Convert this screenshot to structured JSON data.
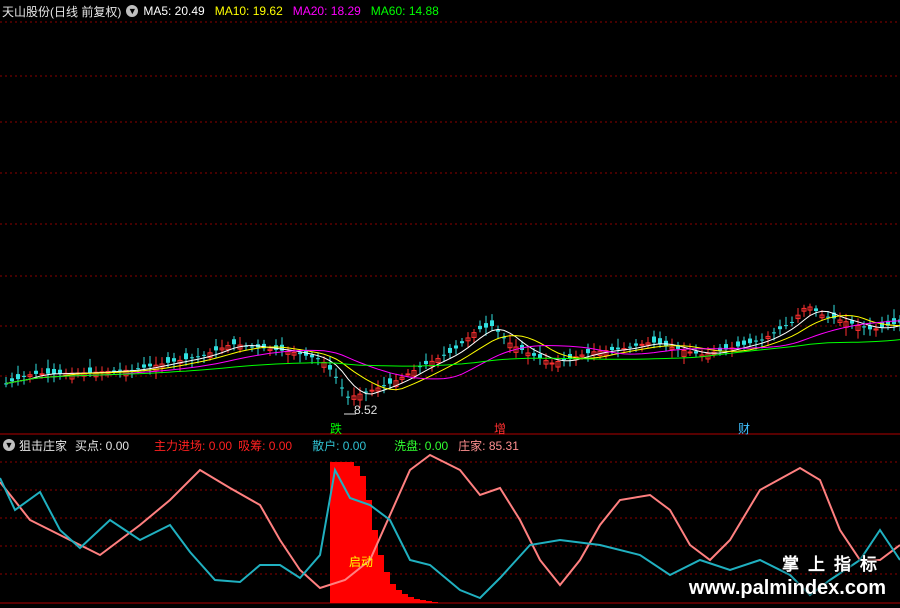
{
  "header": {
    "title": "天山股份(日线 前复权)",
    "ma": [
      {
        "label": "MA5: 20.49",
        "color": "#ffffff"
      },
      {
        "label": "MA10: 19.62",
        "color": "#ffff00"
      },
      {
        "label": "MA20: 18.29",
        "color": "#ff00ff"
      },
      {
        "label": "MA60: 14.88",
        "color": "#00ff00"
      }
    ]
  },
  "annotations": {
    "low_price": "8.52",
    "signal_die": "跌",
    "signal_zeng": "增",
    "signal_cai": "财",
    "qidong": "启动"
  },
  "indicator": {
    "name": "狙击庄家",
    "buy": "买点: 0.00",
    "fields": [
      {
        "label": "主力进场: 0.00",
        "color": "#ff2020"
      },
      {
        "label": "吸筹: 0.00",
        "color": "#ff2020"
      },
      {
        "label": "散户: 0.00",
        "color": "#30c0d0"
      },
      {
        "label": "洗盘: 0.00",
        "color": "#30ff30"
      },
      {
        "label": "庄家: 85.31",
        "color": "#ff9090"
      }
    ]
  },
  "watermark": {
    "cn": "掌上指标",
    "url": "www.palmindex.com"
  },
  "colors": {
    "up": "#ff3030",
    "down": "#30e0e0",
    "grid": "#8b0000",
    "ma5": "#ffffff",
    "ma10": "#ffff00",
    "ma20": "#ff00ff",
    "ma60": "#00ff00",
    "zhuang": "#ff8080",
    "sanhu": "#20b0c0",
    "bar": "#ff0000"
  }
}
